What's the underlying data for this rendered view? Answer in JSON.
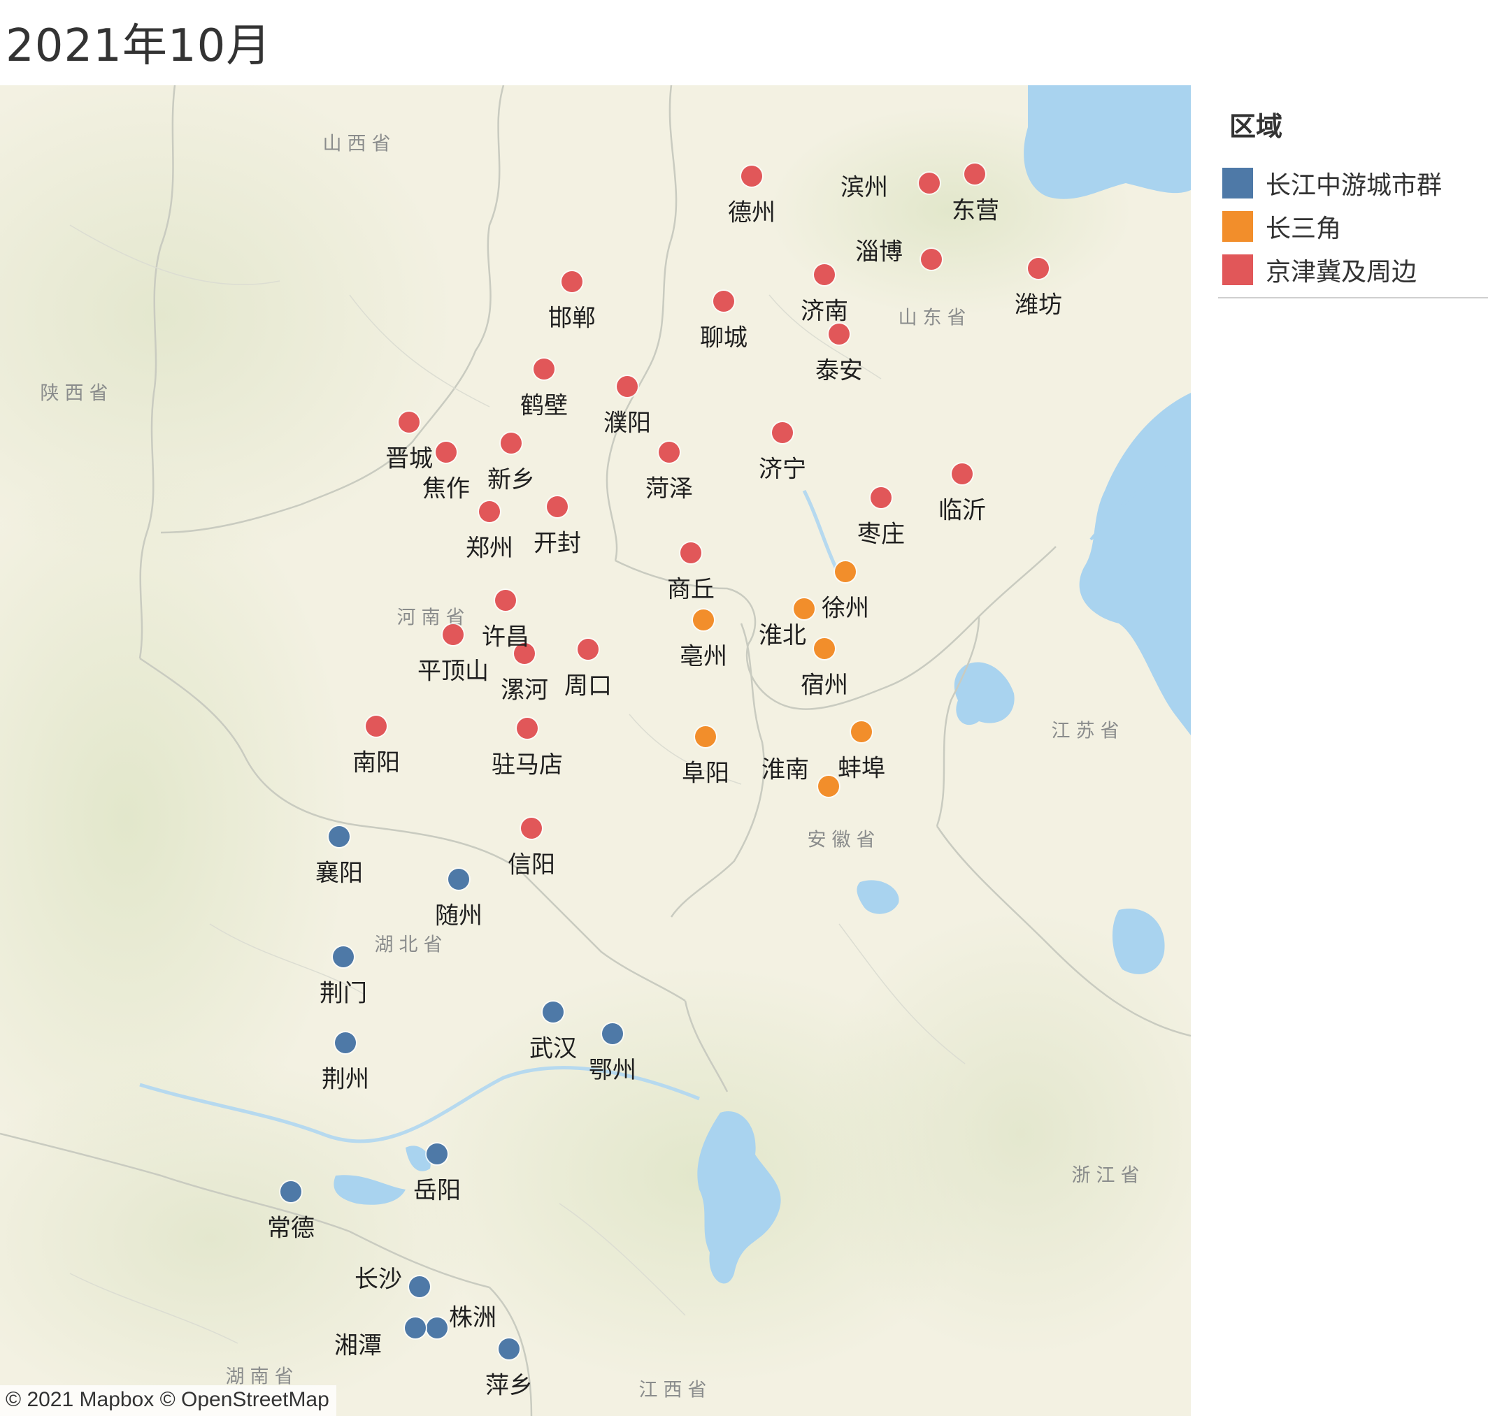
{
  "title": "2021年10月",
  "legend": {
    "title": "区域",
    "items": [
      {
        "label": "长江中游城市群",
        "color": "#4e79a7"
      },
      {
        "label": "长三角",
        "color": "#f28e2b"
      },
      {
        "label": "京津冀及周边",
        "color": "#e15759"
      }
    ]
  },
  "attribution": "© 2021 Mapbox © OpenStreetMap",
  "region_labels": [
    "山西省",
    "陕西省",
    "山东省",
    "河南省",
    "江苏省",
    "安徽省",
    "湖北省",
    "浙江省",
    "江西省",
    "湖南省"
  ],
  "cities": [
    {
      "name": "德州",
      "region": "京津冀及周边"
    },
    {
      "name": "滨州",
      "region": "京津冀及周边"
    },
    {
      "name": "东营",
      "region": "京津冀及周边"
    },
    {
      "name": "淄博",
      "region": "京津冀及周边"
    },
    {
      "name": "潍坊",
      "region": "京津冀及周边"
    },
    {
      "name": "邯郸",
      "region": "京津冀及周边"
    },
    {
      "name": "聊城",
      "region": "京津冀及周边"
    },
    {
      "name": "济南",
      "region": "京津冀及周边"
    },
    {
      "name": "泰安",
      "region": "京津冀及周边"
    },
    {
      "name": "鹤壁",
      "region": "京津冀及周边"
    },
    {
      "name": "濮阳",
      "region": "京津冀及周边"
    },
    {
      "name": "晋城",
      "region": "京津冀及周边"
    },
    {
      "name": "焦作",
      "region": "京津冀及周边"
    },
    {
      "name": "新乡",
      "region": "京津冀及周边"
    },
    {
      "name": "菏泽",
      "region": "京津冀及周边"
    },
    {
      "name": "济宁",
      "region": "京津冀及周边"
    },
    {
      "name": "临沂",
      "region": "京津冀及周边"
    },
    {
      "name": "枣庄",
      "region": "京津冀及周边"
    },
    {
      "name": "郑州",
      "region": "京津冀及周边"
    },
    {
      "name": "开封",
      "region": "京津冀及周边"
    },
    {
      "name": "商丘",
      "region": "京津冀及周边"
    },
    {
      "name": "许昌",
      "region": "京津冀及周边"
    },
    {
      "name": "平顶山",
      "region": "京津冀及周边"
    },
    {
      "name": "漯河",
      "region": "京津冀及周边"
    },
    {
      "name": "周口",
      "region": "京津冀及周边"
    },
    {
      "name": "南阳",
      "region": "京津冀及周边"
    },
    {
      "name": "驻马店",
      "region": "京津冀及周边"
    },
    {
      "name": "信阳",
      "region": "京津冀及周边"
    },
    {
      "name": "徐州",
      "region": "长三角"
    },
    {
      "name": "淮北",
      "region": "长三角"
    },
    {
      "name": "亳州",
      "region": "长三角"
    },
    {
      "name": "宿州",
      "region": "长三角"
    },
    {
      "name": "阜阳",
      "region": "长三角"
    },
    {
      "name": "蚌埠",
      "region": "长三角"
    },
    {
      "name": "淮南",
      "region": "长三角"
    },
    {
      "name": "襄阳",
      "region": "长江中游城市群"
    },
    {
      "name": "随州",
      "region": "长江中游城市群"
    },
    {
      "name": "荆门",
      "region": "长江中游城市群"
    },
    {
      "name": "荆州",
      "region": "长江中游城市群"
    },
    {
      "name": "武汉",
      "region": "长江中游城市群"
    },
    {
      "name": "鄂州",
      "region": "长江中游城市群"
    },
    {
      "name": "岳阳",
      "region": "长江中游城市群"
    },
    {
      "name": "常德",
      "region": "长江中游城市群"
    },
    {
      "name": "长沙",
      "region": "长江中游城市群"
    },
    {
      "name": "株洲",
      "region": "长江中游城市群"
    },
    {
      "name": "湘潭",
      "region": "长江中游城市群"
    },
    {
      "name": "萍乡",
      "region": "长江中游城市群"
    }
  ]
}
